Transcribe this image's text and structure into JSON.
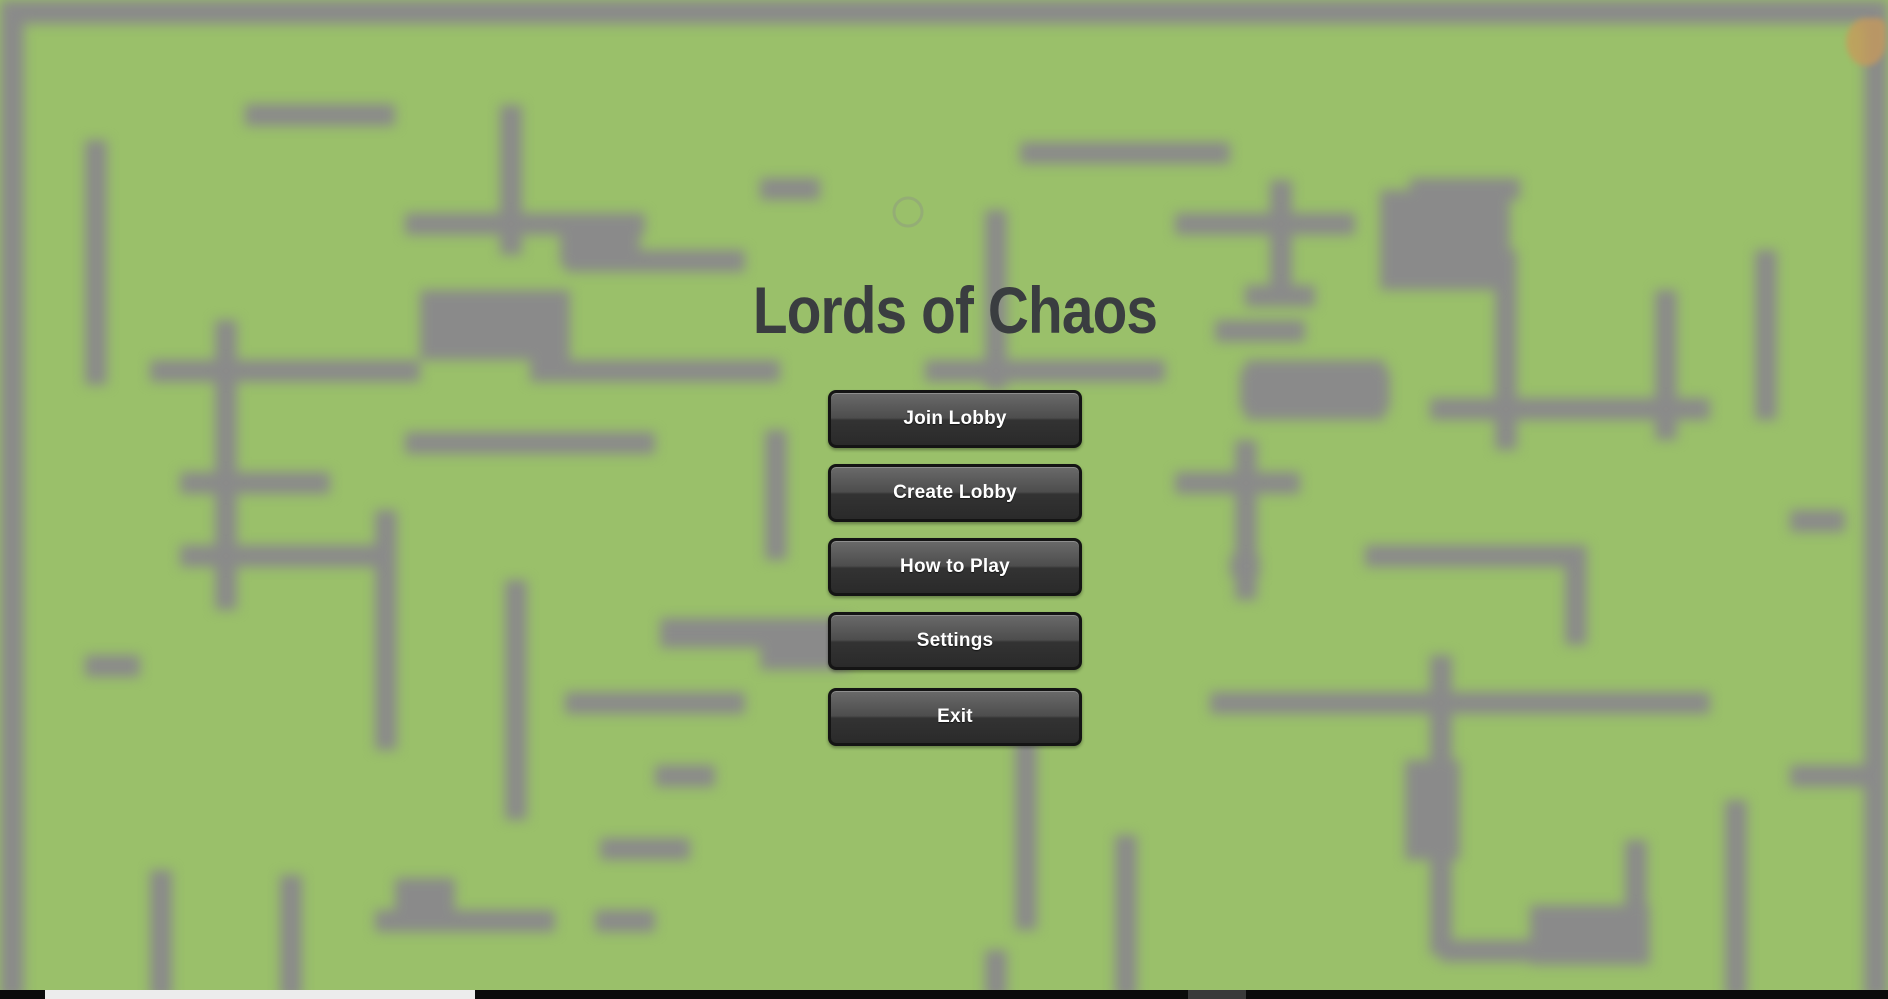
{
  "game": {
    "title": "Lords of Chaos"
  },
  "menu": {
    "join_lobby": "Join Lobby",
    "create_lobby": "Create Lobby",
    "how_to_play": "How to Play",
    "settings": "Settings",
    "exit": "Exit"
  },
  "colors": {
    "background_grass": "#9ac06a",
    "wall_gray": "#8a8a8a",
    "title_text": "#3a3d40",
    "button_dark": "#333333",
    "button_text": "#ffffff"
  },
  "icons": {
    "corner": "player-avatar-icon"
  }
}
